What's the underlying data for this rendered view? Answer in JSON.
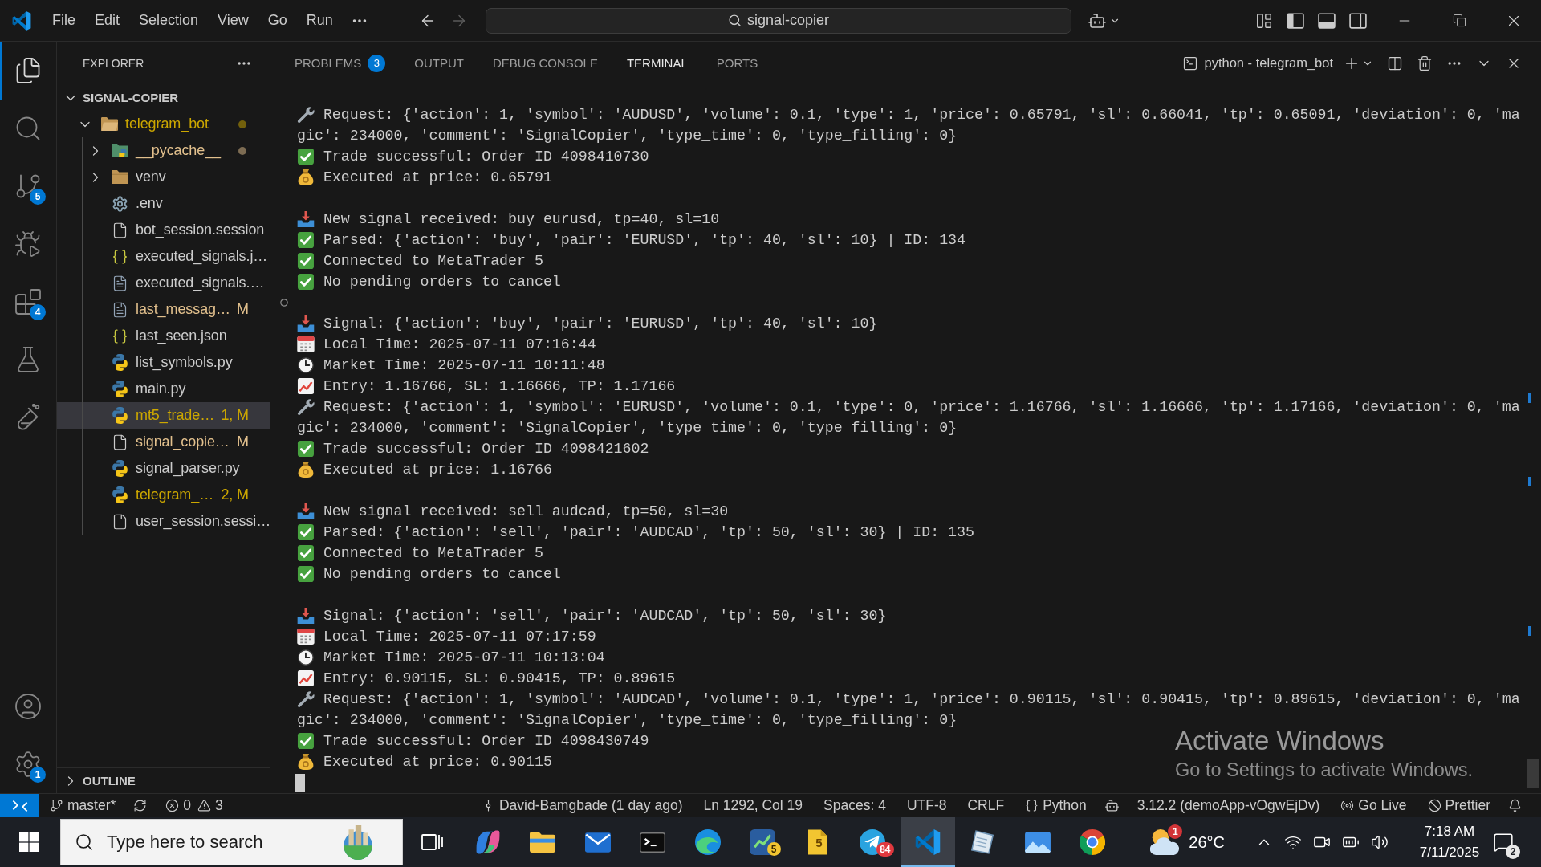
{
  "title_bar": {
    "menu": [
      "File",
      "Edit",
      "Selection",
      "View",
      "Go",
      "Run"
    ],
    "navigation": [
      {
        "kind": "back",
        "disabled": false
      },
      {
        "kind": "forward",
        "disabled": true
      }
    ],
    "command_center": "signal-copier",
    "layout_toggles": [
      {
        "kind": "primary_sidebar",
        "on": true
      },
      {
        "kind": "panel",
        "on": true
      },
      {
        "kind": "secondary_sidebar",
        "on": false
      }
    ]
  },
  "activity_bar": {
    "items": [
      {
        "kind": "explorer",
        "selected": true
      },
      {
        "kind": "search",
        "selected": false
      },
      {
        "kind": "source_control",
        "selected": false,
        "badge": "5"
      },
      {
        "kind": "run_debug",
        "selected": false
      },
      {
        "kind": "extensions",
        "selected": false,
        "badge": "4"
      },
      {
        "kind": "testing",
        "selected": false
      },
      {
        "kind": "lab",
        "selected": false
      }
    ],
    "bottom_items": [
      {
        "kind": "accounts"
      },
      {
        "kind": "settings",
        "badge": "1"
      }
    ]
  },
  "sidebar": {
    "title": "EXPLORER",
    "tree": {
      "name": "SIGNAL-COPIER",
      "expanded": true,
      "children": [
        {
          "name": "telegram_bot",
          "kind": "folder",
          "expanded": true,
          "color": "#cca700",
          "dot": true,
          "selected": false,
          "children": [
            {
              "name": "__pycache__",
              "kind": "python_folder",
              "expanded": false,
              "color": "#e2c08d",
              "dot": true,
              "selected": false
            },
            {
              "name": "venv",
              "kind": "folder",
              "expanded": false,
              "color": "#cccccc",
              "dot": false,
              "selected": false
            },
            {
              "name": ".env",
              "kind": "settings_file",
              "color": "#cccccc",
              "dot": false,
              "selected": false
            },
            {
              "name": "bot_session.session",
              "kind": "file",
              "color": "#cccccc",
              "dot": false,
              "selected": false
            },
            {
              "name": "executed_signals.j…",
              "kind": "json",
              "color": "#cccccc",
              "dot": false,
              "selected": false
            },
            {
              "name": "executed_signals.…",
              "kind": "text",
              "color": "#cccccc",
              "dot": false,
              "selected": false
            },
            {
              "name": "last_messag…",
              "kind": "text",
              "color": "#e2c08d",
              "badge": "M",
              "dot": false,
              "selected": false
            },
            {
              "name": "last_seen.json",
              "kind": "json",
              "color": "#cccccc",
              "dot": false,
              "selected": false
            },
            {
              "name": "list_symbols.py",
              "kind": "python",
              "color": "#cccccc",
              "dot": false,
              "selected": false
            },
            {
              "name": "main.py",
              "kind": "python",
              "color": "#cccccc",
              "dot": false,
              "selected": false
            },
            {
              "name": "mt5_trade…",
              "kind": "python",
              "color": "#cca700",
              "badge": "1, M",
              "dot": false,
              "selected": true
            },
            {
              "name": "signal_copie…",
              "kind": "file",
              "color": "#e2c08d",
              "badge": "M",
              "dot": false,
              "selected": false
            },
            {
              "name": "signal_parser.py",
              "kind": "python",
              "color": "#cccccc",
              "dot": false,
              "selected": false
            },
            {
              "name": "telegram_…",
              "kind": "python",
              "color": "#cca700",
              "badge": "2, M",
              "dot": false,
              "selected": false
            },
            {
              "name": "user_session.sessi…",
              "kind": "file",
              "color": "#cccccc",
              "dot": false,
              "selected": false
            }
          ]
        }
      ]
    },
    "outline": {
      "title": "OUTLINE",
      "expanded": false
    }
  },
  "panel": {
    "tabs": [
      {
        "label": "PROBLEMS",
        "badge": "3",
        "selected": false
      },
      {
        "label": "OUTPUT",
        "selected": false
      },
      {
        "label": "DEBUG CONSOLE",
        "selected": false
      },
      {
        "label": "TERMINAL",
        "selected": true
      },
      {
        "label": "PORTS",
        "selected": false
      }
    ],
    "terminal_title": "python - telegram_bot",
    "terminal": [
      {
        "kind": "wrench",
        "text": "Request: {'action': 1, 'symbol': 'AUDUSD', 'volume': 0.1, 'type': 1, 'price': 0.65791, 'sl': 0.66041, 'tp': 0.65091, 'deviation': 0, 'ma"
      },
      {
        "kind": "wrapped",
        "text": "gic': 234000, 'comment': 'SignalCopier', 'type_time': 0, 'type_filling': 0}"
      },
      {
        "kind": "check",
        "text": "Trade successful: Order ID 4098410730"
      },
      {
        "kind": "moneybag",
        "text": "Executed at price: 0.65791"
      },
      {
        "kind": "blank"
      },
      {
        "kind": "tray",
        "text": "New signal received: buy eurusd, tp=40, sl=10"
      },
      {
        "kind": "check",
        "text": "Parsed: {'action': 'buy', 'pair': 'EURUSD', 'tp': 40, 'sl': 10} | ID: 134"
      },
      {
        "kind": "check",
        "text": "Connected to MetaTrader 5"
      },
      {
        "kind": "check",
        "text": "No pending orders to cancel"
      },
      {
        "kind": "mark"
      },
      {
        "kind": "tray",
        "text": "Signal: {'action': 'buy', 'pair': 'EURUSD', 'tp': 40, 'sl': 10}"
      },
      {
        "kind": "calendar",
        "text": "Local Time: 2025-07-11 07:16:44"
      },
      {
        "kind": "clock",
        "text": "Market Time: 2025-07-11 10:11:48"
      },
      {
        "kind": "chart",
        "text": "Entry: 1.16766, SL: 1.16666, TP: 1.17166"
      },
      {
        "kind": "wrench",
        "text": "Request: {'action': 1, 'symbol': 'EURUSD', 'volume': 0.1, 'type': 0, 'price': 1.16766, 'sl': 1.16666, 'tp': 1.17166, 'deviation': 0, 'ma"
      },
      {
        "kind": "wrapped",
        "text": "gic': 234000, 'comment': 'SignalCopier', 'type_time': 0, 'type_filling': 0}"
      },
      {
        "kind": "check",
        "text": "Trade successful: Order ID 4098421602"
      },
      {
        "kind": "moneybag",
        "text": "Executed at price: 1.16766"
      },
      {
        "kind": "blank"
      },
      {
        "kind": "tray",
        "text": "New signal received: sell audcad, tp=50, sl=30"
      },
      {
        "kind": "check",
        "text": "Parsed: {'action': 'sell', 'pair': 'AUDCAD', 'tp': 50, 'sl': 30} | ID: 135"
      },
      {
        "kind": "check",
        "text": "Connected to MetaTrader 5"
      },
      {
        "kind": "check",
        "text": "No pending orders to cancel"
      },
      {
        "kind": "blank"
      },
      {
        "kind": "tray",
        "text": "Signal: {'action': 'sell', 'pair': 'AUDCAD', 'tp': 50, 'sl': 30}"
      },
      {
        "kind": "calendar",
        "text": "Local Time: 2025-07-11 07:17:59"
      },
      {
        "kind": "clock",
        "text": "Market Time: 2025-07-11 10:13:04"
      },
      {
        "kind": "chart",
        "text": "Entry: 0.90115, SL: 0.90415, TP: 0.89615"
      },
      {
        "kind": "wrench",
        "text": "Request: {'action': 1, 'symbol': 'AUDCAD', 'volume': 0.1, 'type': 1, 'price': 0.90115, 'sl': 0.90415, 'tp': 0.89615, 'deviation': 0, 'ma"
      },
      {
        "kind": "wrapped",
        "text": "gic': 234000, 'comment': 'SignalCopier', 'type_time': 0, 'type_filling': 0}"
      },
      {
        "kind": "check",
        "text": "Trade successful: Order ID 4098430749"
      },
      {
        "kind": "moneybag",
        "text": "Executed at price: 0.90115"
      },
      {
        "kind": "cursor"
      }
    ]
  },
  "status_bar": {
    "branch": "master*",
    "errors": "0",
    "warnings": "3",
    "blame": "David-Bamgbade (1 day ago)",
    "cursor_position": "Ln 1292, Col 19",
    "indentation": "Spaces: 4",
    "encoding": "UTF-8",
    "line_ending": "CRLF",
    "language": "Python",
    "interpreter": "3.12.2 (demoApp-vOgwEjDv)",
    "live_server": "Go Live",
    "formatter": "Prettier"
  },
  "activation_notice": {
    "title": "Activate Windows",
    "message": "Go to Settings to activate Windows."
  },
  "taskbar": {
    "search": {
      "placeholder": "Type here to search"
    },
    "apps": [
      {
        "kind": "task_view",
        "selected": false
      },
      {
        "kind": "copilot",
        "selected": false
      },
      {
        "kind": "folder",
        "selected": false
      },
      {
        "kind": "mail",
        "selected": false
      },
      {
        "kind": "terminal",
        "selected": false
      },
      {
        "kind": "browser",
        "selected": false
      },
      {
        "kind": "trading",
        "selected": false,
        "badge": "5"
      },
      {
        "kind": "editor",
        "selected": false,
        "badge": "5"
      },
      {
        "kind": "messenger",
        "selected": false,
        "badge": "84"
      },
      {
        "kind": "code",
        "selected": true
      },
      {
        "kind": "notes",
        "selected": false
      },
      {
        "kind": "photos",
        "selected": false
      },
      {
        "kind": "chrome",
        "selected": false
      }
    ],
    "weather": {
      "badge": "1",
      "temperature": "26°C"
    },
    "clock": {
      "time": "7:18 AM",
      "date": "7/11/2025"
    },
    "notifications": {
      "badge": "2"
    }
  }
}
